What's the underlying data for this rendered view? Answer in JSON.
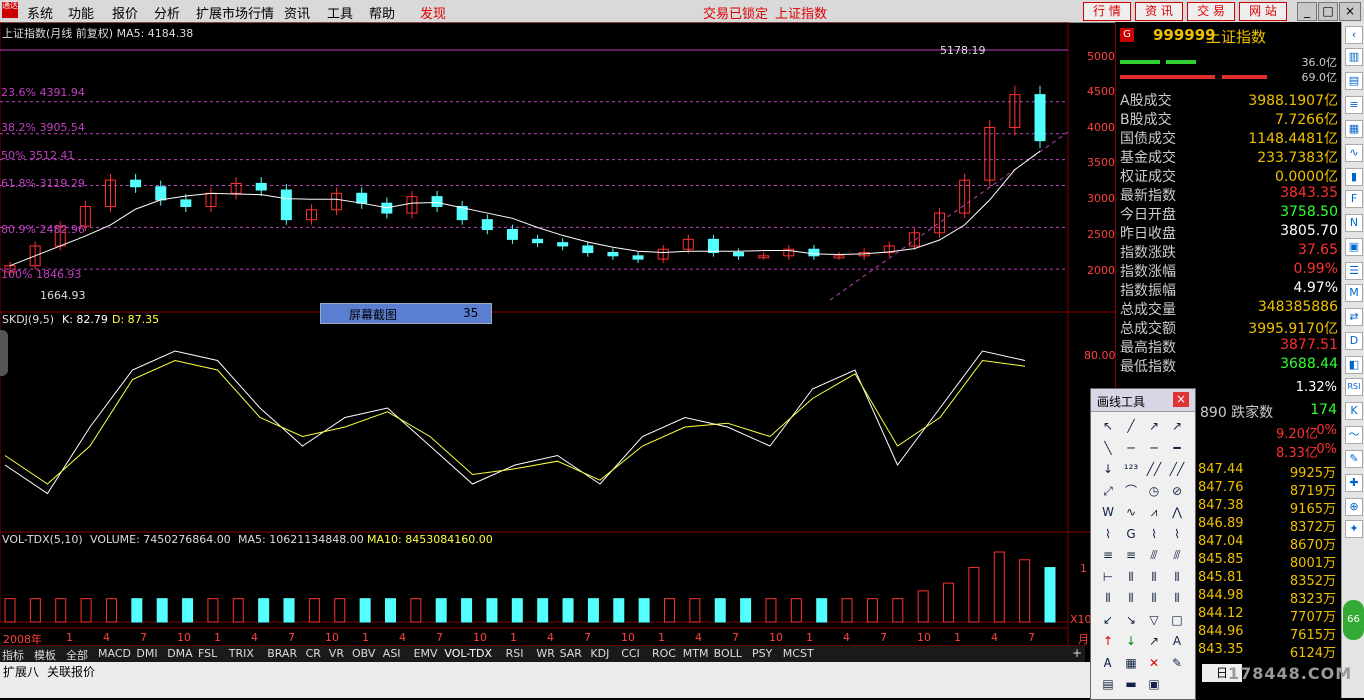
{
  "menubar": {
    "items": [
      "系统",
      "功能",
      "报价",
      "分析",
      "扩展市场行情",
      "资讯",
      "工具",
      "帮助",
      "发现"
    ],
    "lock_text": "交易已锁定",
    "index_text": "上证指数",
    "buttons": [
      "行 情",
      "资 讯",
      "交 易",
      "网 站"
    ]
  },
  "chart": {
    "title": "上证指数(月线 前复权) MA5: 4184.38",
    "high_label": "5178.19",
    "low_label": "1664.93",
    "fib_labels": [
      "23.6% 4391.94",
      "38.2% 3905.54",
      "50% 3512.41",
      "61.8% 3119.29",
      "80.9% 2482.96",
      "100% 1846.93"
    ],
    "price_ticks": [
      "5000",
      "4500",
      "4000",
      "3500",
      "3000",
      "2500",
      "2000"
    ],
    "kdj_title": "SKDJ(9,5)",
    "kdj_k": "K: 82.79",
    "kdj_d": "D: 87.35",
    "kdj_tick": "80.00",
    "vol_title": "VOL-TDX(5,10)",
    "vol_value": "VOLUME: 7450276864.00",
    "vol_ma5": "MA5: 10621134848.00",
    "vol_ma10": "MA10: 8453084160.00",
    "vol_tick": "1",
    "vol_unit": "X10",
    "year_label": "2008年",
    "x_months": [
      "1",
      "4",
      "7",
      "10",
      "1",
      "4",
      "7",
      "10",
      "1",
      "4",
      "7",
      "10",
      "1",
      "4",
      "7",
      "10",
      "1",
      "4",
      "7",
      "10",
      "1",
      "4",
      "7",
      "10",
      "1",
      "4",
      "7"
    ],
    "x_end_label": "月",
    "colors": {
      "up": "#ff3030",
      "down": "#54ffff",
      "ma": "#ffffff",
      "ma10": "#ffff00",
      "fib": "#c040c0"
    }
  },
  "chart_data": {
    "type": "candlestick",
    "title": "上证指数(月线 前复权)",
    "ylim": [
      1500,
      5300
    ],
    "close_series": [
      1900,
      2200,
      2500,
      2800,
      3200,
      3100,
      2900,
      2800,
      3000,
      3150,
      3050,
      2600,
      2750,
      3000,
      2850,
      2700,
      2950,
      2800,
      2600,
      2450,
      2300,
      2250,
      2200,
      2100,
      2050,
      2000,
      2150,
      2300,
      2100,
      2050,
      2050,
      2150,
      2050,
      2050,
      2100,
      2200,
      2400,
      2700,
      3200,
      4000,
      4500,
      3800
    ],
    "high_marker": 5178.19,
    "low_marker": 1664.93,
    "kdj_k_series": [
      30,
      15,
      50,
      80,
      90,
      85,
      60,
      40,
      55,
      60,
      40,
      20,
      30,
      35,
      20,
      45,
      55,
      50,
      40,
      70,
      80,
      30,
      60,
      90,
      85
    ],
    "kdj_d_series": [
      35,
      20,
      40,
      75,
      85,
      80,
      55,
      45,
      50,
      58,
      45,
      25,
      28,
      32,
      22,
      40,
      50,
      52,
      45,
      65,
      78,
      40,
      55,
      85,
      82
    ],
    "volume_series": [
      3,
      3,
      3,
      3,
      3,
      3,
      3,
      3,
      3,
      3,
      3,
      3,
      3,
      3,
      3,
      3,
      3,
      3,
      3,
      3,
      3,
      3,
      3,
      3,
      3,
      3,
      3,
      3,
      3,
      3,
      3,
      3,
      3,
      3,
      3,
      3,
      4,
      5,
      7,
      9,
      8,
      7
    ]
  },
  "popup": {
    "label": "屏幕截图",
    "value": "35"
  },
  "right_panel": {
    "code": "999999",
    "name": "上证指数",
    "bar_value1": "36.0亿",
    "bar_value2": "69.0亿",
    "rows": [
      {
        "k": "A股成交",
        "v": "3988.1907亿",
        "c": "#f0c000"
      },
      {
        "k": "B股成交",
        "v": "7.7266亿",
        "c": "#f0c000"
      },
      {
        "k": "国债成交",
        "v": "1148.4481亿",
        "c": "#f0c000"
      },
      {
        "k": "基金成交",
        "v": "233.7383亿",
        "c": "#f0c000"
      },
      {
        "k": "权证成交",
        "v": "0.0000亿",
        "c": "#f0c000"
      },
      {
        "k": "最新指数",
        "v": "3843.35",
        "c": "#ff3030"
      },
      {
        "k": "今日开盘",
        "v": "3758.50",
        "c": "#30ff30"
      },
      {
        "k": "昨日收盘",
        "v": "3805.70",
        "c": "#ffffff"
      },
      {
        "k": "指数涨跌",
        "v": "37.65",
        "c": "#ff3030"
      },
      {
        "k": "指数涨幅",
        "v": "0.99%",
        "c": "#ff3030"
      },
      {
        "k": "指数振幅",
        "v": "4.97%",
        "c": "#ffffff"
      },
      {
        "k": "总成交量",
        "v": "348385886",
        "c": "#f0c000"
      },
      {
        "k": "总成交额",
        "v": "3995.9170亿",
        "c": "#f0c000"
      },
      {
        "k": "最高指数",
        "v": "3877.51",
        "c": "#ff3030"
      },
      {
        "k": "最低指数",
        "v": "3688.44",
        "c": "#30ff30"
      }
    ],
    "partial_row": "1.32%",
    "fall_label": "890 跌家数",
    "fall_value": "174",
    "amt_rows": [
      {
        "a": "9.20亿",
        "b": "0%"
      },
      {
        "a": "8.33亿",
        "b": "0%"
      }
    ],
    "ticks": [
      {
        "p": "847.44",
        "q": "9925万"
      },
      {
        "p": "847.76",
        "q": "8719万"
      },
      {
        "p": "847.38",
        "q": "9165万"
      },
      {
        "p": "846.89",
        "q": "8372万"
      },
      {
        "p": "847.04",
        "q": "8670万"
      },
      {
        "p": "845.85",
        "q": "8001万"
      },
      {
        "p": "845.81",
        "q": "8352万"
      },
      {
        "p": "844.98",
        "q": "8323万"
      },
      {
        "p": "844.12",
        "q": "7707万"
      },
      {
        "p": "844.96",
        "q": "7615万"
      },
      {
        "p": "843.35",
        "q": "6124万"
      }
    ],
    "bottom_label": "日"
  },
  "tabs": [
    "指标",
    "模板",
    "全部",
    "MACD",
    "DMI",
    "DMA",
    "FSL",
    "TRIX",
    "BRAR",
    "CR",
    "VR",
    "OBV",
    "ASI",
    "EMV",
    "VOL-TDX",
    "RSI",
    "WR",
    "SAR",
    "KDJ",
    "CCI",
    "ROC",
    "MTM",
    "BOLL",
    "PSY",
    "MCST"
  ],
  "tab_plus": "+",
  "bottom_tabs": [
    "扩展八",
    "关联报价"
  ],
  "drawtool": {
    "title": "画线工具",
    "close": "×"
  },
  "watermark": "178448.COM"
}
